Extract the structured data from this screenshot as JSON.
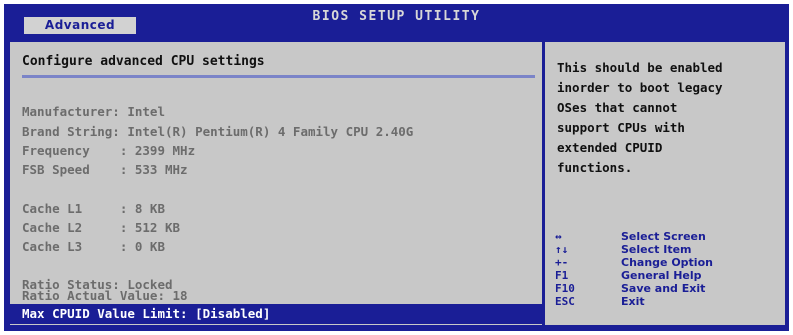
{
  "header": {
    "title": "BIOS SETUP UTILITY",
    "tab": "Advanced"
  },
  "main": {
    "heading": "Configure advanced CPU settings",
    "lines": [
      "Manufacturer: Intel",
      "Brand String: Intel(R) Pentium(R) 4 Family CPU 2.40G",
      "Frequency    : 2399 MHz",
      "FSB Speed    : 533 MHz",
      "Cache L1     : 8 KB",
      "Cache L2     : 512 KB",
      "Cache L3     : 0 KB",
      "Ratio Status: Locked",
      "Ratio Actual Value: 18"
    ],
    "selected_item": "Max CPUID Value Limit: [Disabled]"
  },
  "help": {
    "lines": [
      "This should be enabled",
      "inorder to boot legacy",
      "OSes that cannot",
      "support CPUs with",
      "extended CPUID",
      "functions."
    ]
  },
  "keys": [
    {
      "key": "↔",
      "icon": "left-right-arrows-icon",
      "desc": "Select Screen"
    },
    {
      "key": "↑↓",
      "icon": "up-down-arrows-icon",
      "desc": "Select Item"
    },
    {
      "key": "+-",
      "icon": "plus-minus-icon",
      "desc": "Change Option"
    },
    {
      "key": "F1",
      "icon": "",
      "desc": "General Help"
    },
    {
      "key": "F10",
      "icon": "",
      "desc": "Save and Exit"
    },
    {
      "key": "ESC",
      "icon": "",
      "desc": "Exit"
    }
  ],
  "colors": {
    "blue": "#1a1e96",
    "gray_panel": "#c8c8c8",
    "dim_text": "#6c6c6c",
    "tab_bg": "#d2d2d2"
  }
}
